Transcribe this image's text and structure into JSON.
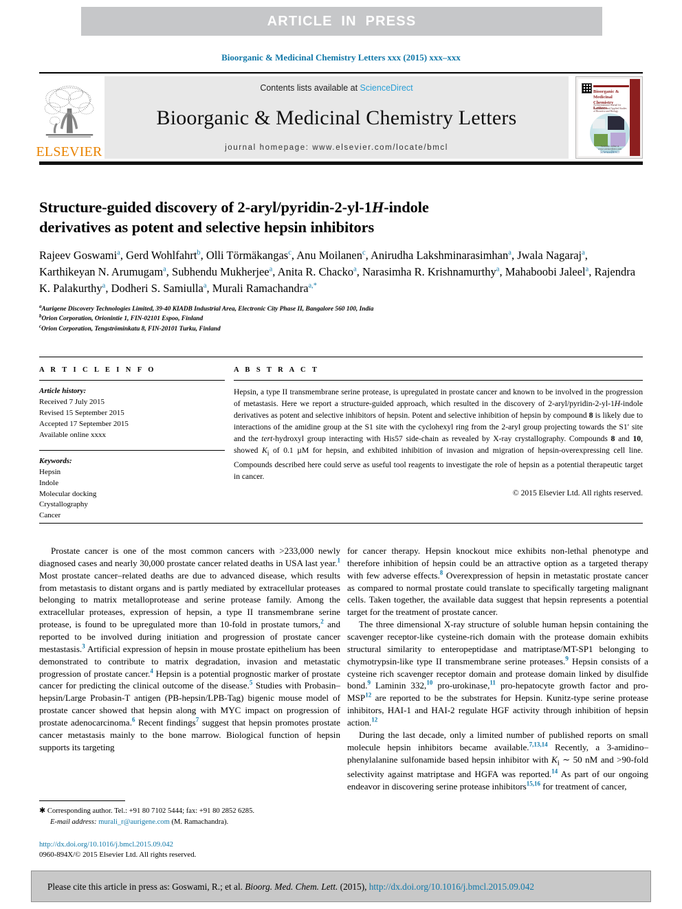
{
  "banner": {
    "text": "ARTICLE IN PRESS"
  },
  "running_head": "Bioorganic & Medicinal Chemistry Letters xxx (2015) xxx–xxx",
  "masthead": {
    "contents_prefix": "Contents lists available at ",
    "sciencedirect": "ScienceDirect",
    "journal_title": "Bioorganic & Medicinal Chemistry Letters",
    "homepage": "journal homepage: www.elsevier.com/locate/bmcl",
    "publisher": "ELSEVIER",
    "cover": {
      "title": "Bioorganic & Medicinal Chemistry Letters",
      "subtitle": "An International Journal for Fundamental and Applied Studies of Bioactive and Biology",
      "tagline": "25th Anniversary Volume",
      "footer": "Available online at www.sciencedirect.com",
      "brand": "ScienceDirect"
    }
  },
  "article": {
    "title_line1": "Structure-guided discovery of 2-aryl/pyridin-2-yl-1",
    "title_italic": "H",
    "title_line1_end": "-indole",
    "title_line2": "derivatives as potent and selective hepsin inhibitors",
    "authors": [
      {
        "name": "Rajeev Goswami",
        "sup": "a",
        "sep": ", "
      },
      {
        "name": "Gerd Wohlfahrt",
        "sup": "b",
        "sep": ", "
      },
      {
        "name": "Olli Törmäkangas",
        "sup": "c",
        "sep": ", "
      },
      {
        "name": "Anu Moilanen",
        "sup": "c",
        "sep": ", "
      },
      {
        "name": "Anirudha Lakshminarasimhan",
        "sup": "a",
        "sep": ", "
      },
      {
        "name": "Jwala Nagaraj",
        "sup": "a",
        "sep": ", "
      },
      {
        "name": "Karthikeyan N. Arumugam",
        "sup": "a",
        "sep": ", "
      },
      {
        "name": "Subhendu Mukherjee",
        "sup": "a",
        "sep": ", "
      },
      {
        "name": "Anita R. Chacko",
        "sup": "a",
        "sep": ", "
      },
      {
        "name": "Narasimha R. Krishnamurthy",
        "sup": "a",
        "sep": ", "
      },
      {
        "name": "Mahaboobi Jaleel",
        "sup": "a",
        "sep": ", "
      },
      {
        "name": "Rajendra K. Palakurthy",
        "sup": "a",
        "sep": ", "
      },
      {
        "name": "Dodheri S. Samiulla",
        "sup": "a",
        "sep": ", "
      },
      {
        "name": "Murali Ramachandra",
        "sup": "a,*",
        "sep": ""
      }
    ],
    "affiliations": [
      {
        "sup": "a",
        "text": "Aurigene Discovery Technologies Limited, 39-40 KIADB Industrial Area, Electronic City Phase II, Bangalore 560 100, India"
      },
      {
        "sup": "b",
        "text": "Orion Corporation, Orionintie 1, FIN-02101 Espoo, Finland"
      },
      {
        "sup": "c",
        "text": "Orion Corporation, Tengströminkatu 8, FIN-20101 Turku, Finland"
      }
    ]
  },
  "article_info": {
    "heading": "A R T I C L E   I N F O",
    "history_label": "Article history:",
    "history": [
      "Received 7 July 2015",
      "Revised 15 September 2015",
      "Accepted 17 September 2015",
      "Available online xxxx"
    ],
    "keywords_label": "Keywords:",
    "keywords": [
      "Hepsin",
      "Indole",
      "Molecular docking",
      "Crystallography",
      "Cancer"
    ]
  },
  "abstract": {
    "heading": "A B S T R A C T",
    "copyright": "© 2015 Elsevier Ltd. All rights reserved."
  },
  "body": {
    "left_paragraphs": [
      "Prostate cancer is one of the most common cancers with >233,000 newly diagnosed cases and nearly 30,000 prostate cancer related deaths in USA last year.[1] Most prostate cancer–related deaths are due to advanced disease, which results from metastasis to distant organs and is partly mediated by extracellular proteases belonging to matrix metalloprotease and serine protease family. Among the extracellular proteases, expression of hepsin, a type II transmembrane serine protease, is found to be upregulated more than 10-fold in prostate tumors,[2] and reported to be involved during initiation and progression of prostate cancer mestastasis.[3] Artificial expression of hepsin in mouse prostate epithelium has been demonstrated to contribute to matrix degradation, invasion and metastatic progression of prostate cancer.[4] Hepsin is a potential prognostic marker of prostate cancer for predicting the clinical outcome of the disease.[5] Studies with Probasin–hepsin/Large Probasin-T antigen (PB-hepsin/LPB-Tag) bigenic mouse model of prostate cancer showed that hepsin along with MYC impact on progression of prostate adenocarcinoma.[6] Recent findings[7] suggest that hepsin promotes prostate cancer metastasis mainly to the bone marrow. Biological function of hepsin supports its targeting"
    ],
    "right_paragraphs": [
      "for cancer therapy. Hepsin knockout mice exhibits non-lethal phenotype and therefore inhibition of hepsin could be an attractive option as a targeted therapy with few adverse effects.[8] Overexpression of hepsin in metastatic prostate cancer as compared to normal prostate could translate to specifically targeting malignant cells. Taken together, the available data suggest that hepsin represents a potential target for the treatment of prostate cancer.",
      "The three dimensional X-ray structure of soluble human hepsin containing the scavenger receptor-like cysteine-rich domain with the protease domain exhibits structural similarity to enteropeptidase and matriptase/MT-SP1 belonging to chymotrypsin-like type II transmembrane serine proteases.[9] Hepsin consists of a cysteine rich scavenger receptor domain and protease domain linked by disulfide bond.[9] Laminin 332,[10] pro-urokinase,[11] pro-hepatocyte growth factor and pro-MSP[12] are reported to be the substrates for Hepsin. Kunitz-type serine protease inhibitors, HAI-1 and HAI-2 regulate HGF activity through inhibition of hepsin action.[12]",
      "During the last decade, only a limited number of published reports on small molecule hepsin inhibitors became available.[7,13,14] Recently, a 3-amidino-phenylalanine sulfonamide based hepsin inhibitor with Ki ~ 50 nM and >90-fold selectivity against matriptase and HGFA was reported.[14] As part of our ongoing endeavor in discovering serine protease inhibitors[15,16] for treatment of cancer,"
    ]
  },
  "footnote": {
    "corresponding": "Corresponding author. Tel.: +91 80 7102 5444; fax: +91 80 2852 6285.",
    "email_label": "E-mail address:",
    "email": "murali_r@aurigene.com",
    "email_owner": "(M. Ramachandra)."
  },
  "issn": {
    "doi": "http://dx.doi.org/10.1016/j.bmcl.2015.09.042",
    "copyright": "0960-894X/© 2015 Elsevier Ltd. All rights reserved."
  },
  "cite_bar": {
    "prefix": "Please cite this article in press as: Goswami, R.; et al. ",
    "journal": "Bioorg. Med. Chem. Lett.",
    "year": " (2015), ",
    "doi": "http://dx.doi.org/10.1016/j.bmcl.2015.09.042"
  },
  "colors": {
    "link": "#1178a8",
    "banner_bg": "#c6c7c9",
    "elsevier_orange": "#e98300",
    "sciencedirect": "#2a9fd6"
  }
}
